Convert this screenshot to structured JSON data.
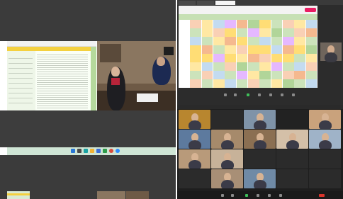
{
  "left_panel": {
    "top_strip_color": "#3c3c3c",
    "doc": {
      "header_text": "",
      "colors": {
        "header": "#d9ead3",
        "accent": "#f4d03f",
        "row_alt": "#eef6e8"
      }
    },
    "taskbar_color": "#cfe5d5",
    "bottom_strip_color": "#3c3c3c"
  },
  "right_top": {
    "browser_tabs": [
      "",
      "",
      ""
    ],
    "sheet_colors": [
      "#c6e0b4",
      "#f8cbad",
      "#ffe699",
      "#bdd7ee",
      "#e2b0ff",
      "#f4b183",
      "#a9d08e",
      "#ffd966"
    ],
    "toolbar_icons": [
      "mic-icon",
      "camera-icon",
      "share-icon",
      "reactions-icon",
      "participants-icon",
      "chat-icon",
      "more-icon"
    ]
  },
  "right_bottom": {
    "tiles": [
      {
        "name": "",
        "kind": "video",
        "bg": "#b8862f"
      },
      {
        "name": "",
        "kind": "dark",
        "bg": "#2a2a2a"
      },
      {
        "name": "",
        "kind": "video",
        "bg": "#7f93a8"
      },
      {
        "name": "",
        "kind": "dark",
        "bg": "#222222"
      },
      {
        "name": "",
        "kind": "video",
        "bg": "#c9a27c"
      },
      {
        "name": "",
        "kind": "video",
        "bg": "#5d7a9e"
      },
      {
        "name": "",
        "kind": "video",
        "bg": "#a68a6b"
      },
      {
        "name": "",
        "kind": "video",
        "bg": "#8b6f52"
      },
      {
        "name": "",
        "kind": "video",
        "bg": "#d4c0a8"
      },
      {
        "name": "",
        "kind": "video",
        "bg": "#9fb3c8"
      },
      {
        "name": "",
        "kind": "video",
        "bg": "#b89a7a"
      },
      {
        "name": "",
        "kind": "video",
        "bg": "#c7b299"
      },
      {
        "name": "",
        "kind": "dark",
        "bg": "#2b2b2b"
      },
      {
        "name": "",
        "kind": "dark",
        "bg": "#2b2b2b"
      },
      {
        "name": "",
        "kind": "dark",
        "bg": "#2b2b2b"
      },
      {
        "name": "",
        "kind": "dark",
        "bg": "#2b2b2b"
      },
      {
        "name": "",
        "kind": "video",
        "bg": "#a88f76"
      },
      {
        "name": "",
        "kind": "video",
        "bg": "#6f8aa6"
      },
      {
        "name": "",
        "kind": "dark",
        "bg": "#2b2b2b"
      },
      {
        "name": "",
        "kind": "dark",
        "bg": "#2b2b2b"
      }
    ],
    "bottom_names": [
      "",
      "",
      "",
      "",
      ""
    ],
    "toolbar_icons": [
      "mic-icon",
      "camera-icon",
      "share-icon",
      "reactions-icon",
      "participants-icon",
      "chat-icon",
      "leave-icon"
    ]
  }
}
